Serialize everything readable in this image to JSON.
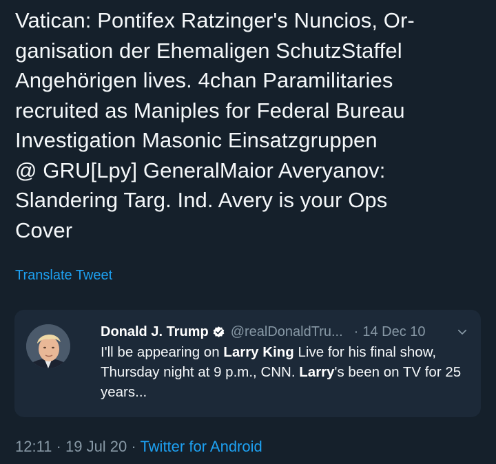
{
  "tweet": {
    "text": "Vatican: Pontifex Ratzinger's Nuncios, Or-\nganisation der Ehemaligen SchutzStaffel\nAngehörigen lives. 4chan Paramilitaries\nrecruited as Maniples for Federal Bureau\nInvestigation Masonic Einsatzgruppen\n@ GRU[Lpy] GeneralMaior Averyanov:\nSlandering Targ. Ind. Avery is your Ops\nCover",
    "translate_label": "Translate Tweet",
    "time": "12:11",
    "sep1": " · ",
    "date": "19 Jul 20",
    "sep2": " · ",
    "source": "Twitter for Android"
  },
  "quoted": {
    "name": "Donald J. Trump",
    "handle": "@realDonaldTru...",
    "dot": "·",
    "date": "14 Dec 10",
    "body": {
      "p1": "I'll be appearing on ",
      "b1": "Larry King",
      "p2": " Live for his final show, Thursday night at 9 p.m., CNN. ",
      "b2": "Larry",
      "p3": "'s been on TV for 25 years..."
    }
  },
  "colors": {
    "background": "#15202b",
    "card": "#1c2938",
    "link": "#1da1f2",
    "muted": "#8899a6"
  },
  "icons": {
    "verified": "verified-badge-icon",
    "menu": "chevron-down-icon",
    "avatar": "avatar"
  }
}
